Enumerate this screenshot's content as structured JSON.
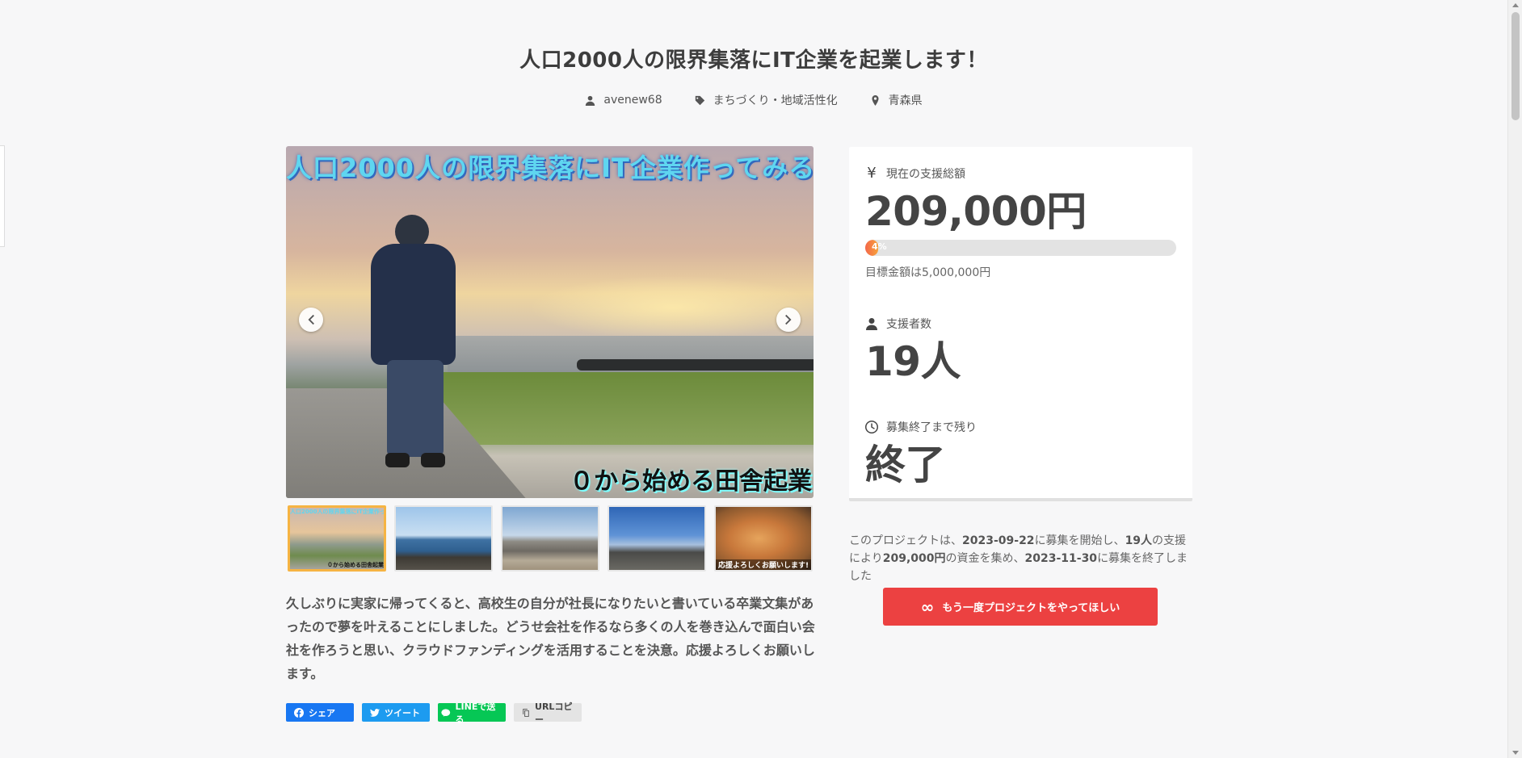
{
  "project": {
    "title": "人口2000人の限界集落にIT企業を起業します！",
    "author": "avenew68",
    "category": "まちづくり・地域活性化",
    "location": "青森県"
  },
  "gallery": {
    "overlay_top": "人口2000人の限界集落にIT企業作ってみる",
    "overlay_bottom": "０から始める田舎起業",
    "thumb1_caption_top": "人口2000人の限界集落にIT企業作ってみる",
    "thumb1_caption_bottom": "０から始める田舎起業",
    "thumb5_caption": "応援よろしくお願いします!"
  },
  "description": "久しぶりに実家に帰ってくると、高校生の自分が社長になりたいと書いている卒業文集があったので夢を叶えることにしました。どうせ会社を作るなら多くの人を巻き込んで面白い会社を作ろうと思い、クラウドファンディングを活用することを決意。応援よろしくお願いします。",
  "share": {
    "facebook": "シェア",
    "twitter": "ツイート",
    "line": "LINEで送る",
    "copy": "URLコピー"
  },
  "stats": {
    "amount_label": "現在の支援総額",
    "amount_value": "209,000円",
    "progress_text": "4%",
    "progress_fraction": 0.042,
    "goal_text": "目標金額は5,000,000円",
    "backers_label": "支援者数",
    "backers_value": "19人",
    "remaining_label": "募集終了まで残り",
    "remaining_value": "終了"
  },
  "summary": {
    "p1": "このプロジェクトは、",
    "start_date": "2023-09-22",
    "p2": "に募集を開始し、",
    "backers": "19人",
    "p3": "の支援により",
    "amount": "209,000円",
    "p4": "の資金を集め、",
    "end_date": "2023-11-30",
    "p5": "に募集を終了しました"
  },
  "rerun_button": "もう一度プロジェクトをやってほしい",
  "colors": {
    "accent_red": "#ec4141",
    "progress_orange": "#f4674a",
    "facebook": "#1877f2",
    "twitter": "#1d9bf0",
    "line": "#06c755"
  }
}
